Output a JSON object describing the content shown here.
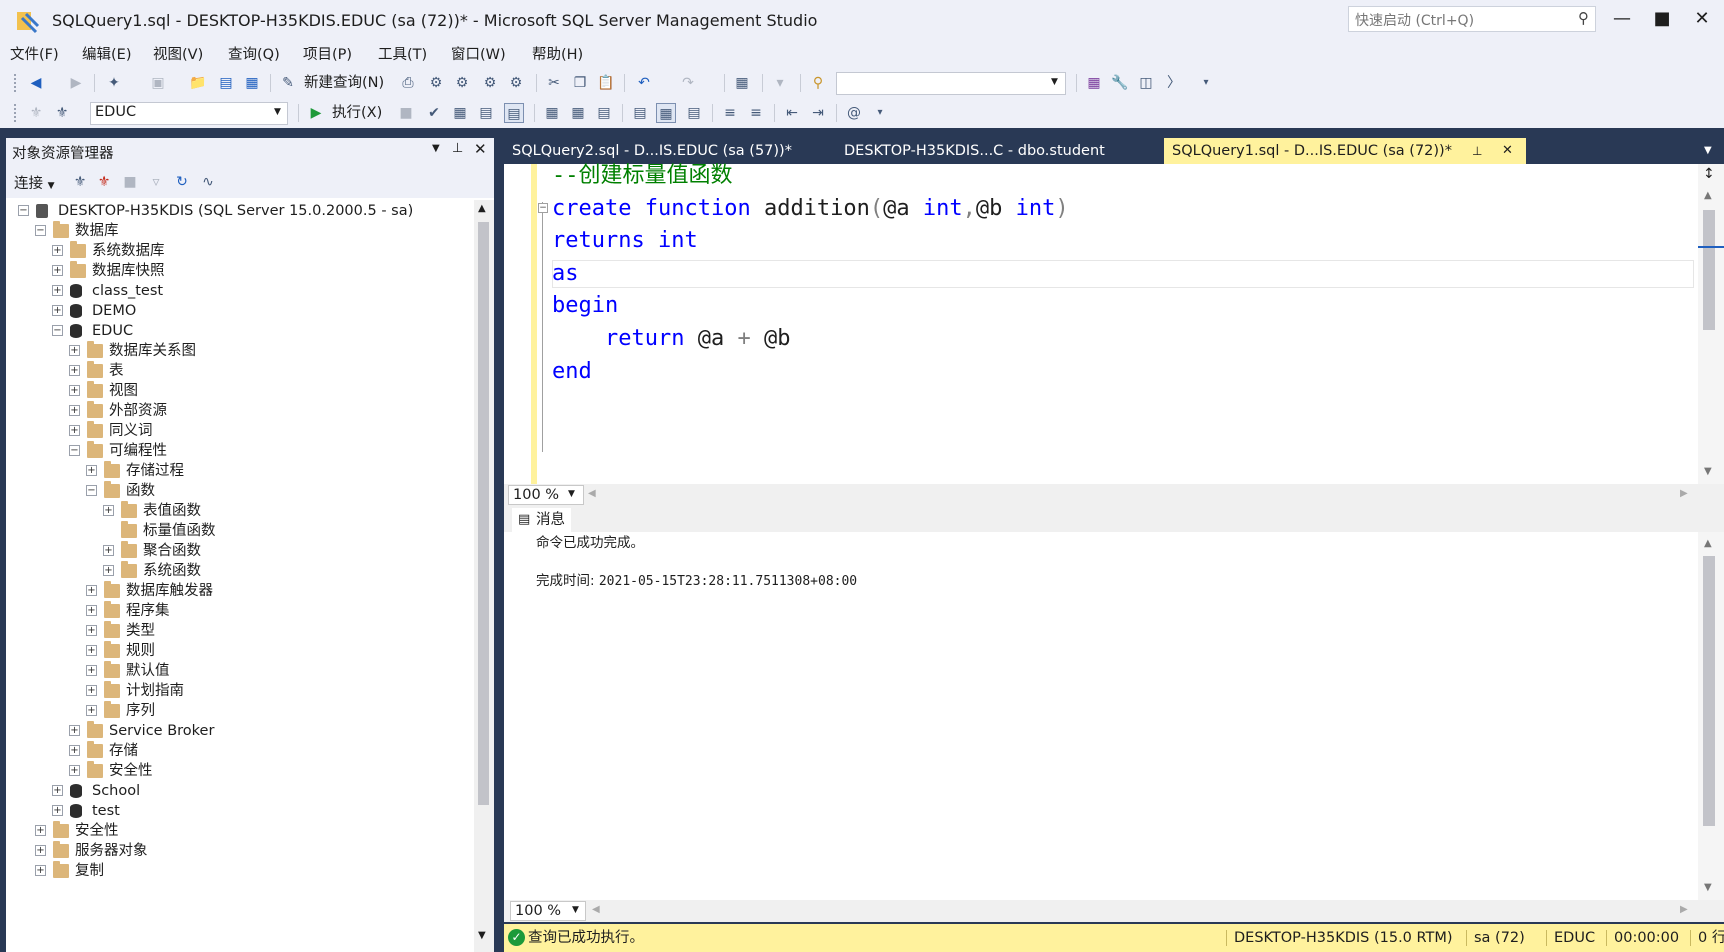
{
  "window": {
    "title": "SQLQuery1.sql - DESKTOP-H35KDIS.EDUC (sa (72))* - Microsoft SQL Server Management Studio",
    "quick_launch_placeholder": "快速启动 (Ctrl+Q)"
  },
  "menu": [
    "文件(F)",
    "编辑(E)",
    "视图(V)",
    "查询(Q)",
    "项目(P)",
    "工具(T)",
    "窗口(W)",
    "帮助(H)"
  ],
  "toolbar": {
    "new_query_label": "新建查询(N)",
    "execute_label": "执行(X)",
    "database_selected": "EDUC"
  },
  "object_explorer": {
    "title": "对象资源管理器",
    "connect_label": "连接",
    "tree": [
      {
        "label": "DESKTOP-H35KDIS (SQL Server 15.0.2000.5 - sa)",
        "level": 0,
        "expander": "−",
        "icon": "server-icon"
      },
      {
        "label": "数据库",
        "level": 1,
        "expander": "−",
        "icon": "folder-icon"
      },
      {
        "label": "系统数据库",
        "level": 2,
        "expander": "+",
        "icon": "folder-icon"
      },
      {
        "label": "数据库快照",
        "level": 2,
        "expander": "+",
        "icon": "folder-icon"
      },
      {
        "label": "class_test",
        "level": 2,
        "expander": "+",
        "icon": "database-icon"
      },
      {
        "label": "DEMO",
        "level": 2,
        "expander": "+",
        "icon": "database-icon"
      },
      {
        "label": "EDUC",
        "level": 2,
        "expander": "−",
        "icon": "database-icon"
      },
      {
        "label": "数据库关系图",
        "level": 3,
        "expander": "+",
        "icon": "folder-icon"
      },
      {
        "label": "表",
        "level": 3,
        "expander": "+",
        "icon": "folder-icon"
      },
      {
        "label": "视图",
        "level": 3,
        "expander": "+",
        "icon": "folder-icon"
      },
      {
        "label": "外部资源",
        "level": 3,
        "expander": "+",
        "icon": "folder-icon"
      },
      {
        "label": "同义词",
        "level": 3,
        "expander": "+",
        "icon": "folder-icon"
      },
      {
        "label": "可编程性",
        "level": 3,
        "expander": "−",
        "icon": "folder-icon"
      },
      {
        "label": "存储过程",
        "level": 4,
        "expander": "+",
        "icon": "folder-icon"
      },
      {
        "label": "函数",
        "level": 4,
        "expander": "−",
        "icon": "folder-icon"
      },
      {
        "label": "表值函数",
        "level": 5,
        "expander": "+",
        "icon": "folder-icon"
      },
      {
        "label": "标量值函数",
        "level": 5,
        "expander": "",
        "icon": "folder-icon"
      },
      {
        "label": "聚合函数",
        "level": 5,
        "expander": "+",
        "icon": "folder-icon"
      },
      {
        "label": "系统函数",
        "level": 5,
        "expander": "+",
        "icon": "folder-icon"
      },
      {
        "label": "数据库触发器",
        "level": 4,
        "expander": "+",
        "icon": "folder-icon"
      },
      {
        "label": "程序集",
        "level": 4,
        "expander": "+",
        "icon": "folder-icon"
      },
      {
        "label": "类型",
        "level": 4,
        "expander": "+",
        "icon": "folder-icon"
      },
      {
        "label": "规则",
        "level": 4,
        "expander": "+",
        "icon": "folder-icon"
      },
      {
        "label": "默认值",
        "level": 4,
        "expander": "+",
        "icon": "folder-icon"
      },
      {
        "label": "计划指南",
        "level": 4,
        "expander": "+",
        "icon": "folder-icon"
      },
      {
        "label": "序列",
        "level": 4,
        "expander": "+",
        "icon": "folder-icon"
      },
      {
        "label": "Service Broker",
        "level": 3,
        "expander": "+",
        "icon": "folder-icon"
      },
      {
        "label": "存储",
        "level": 3,
        "expander": "+",
        "icon": "folder-icon"
      },
      {
        "label": "安全性",
        "level": 3,
        "expander": "+",
        "icon": "folder-icon"
      },
      {
        "label": "School",
        "level": 2,
        "expander": "+",
        "icon": "database-icon"
      },
      {
        "label": "test",
        "level": 2,
        "expander": "+",
        "icon": "database-icon"
      },
      {
        "label": "安全性",
        "level": 1,
        "expander": "+",
        "icon": "folder-icon"
      },
      {
        "label": "服务器对象",
        "level": 1,
        "expander": "+",
        "icon": "folder-icon"
      },
      {
        "label": "复制",
        "level": 1,
        "expander": "+",
        "icon": "folder-icon"
      }
    ]
  },
  "tabs": [
    {
      "label": "SQLQuery2.sql - D...IS.EDUC (sa (57))*",
      "active": false
    },
    {
      "label": "DESKTOP-H35KDIS...C - dbo.student",
      "active": false
    },
    {
      "label": "SQLQuery1.sql - D...IS.EDUC (sa (72))*",
      "active": true
    }
  ],
  "editor": {
    "lines": [
      "--创建标量值函数",
      "create function addition(@a int,@b int)",
      "returns int",
      "as",
      "begin",
      "    return @a + @b",
      "end"
    ],
    "zoom": "100 %"
  },
  "results": {
    "tab_label": "消息",
    "message_line1": "命令已成功完成。",
    "completion_label": "完成时间: ",
    "completion_time": "2021-05-15T23:28:11.7511308+08:00",
    "zoom": "100 %"
  },
  "status": {
    "message": "查询已成功执行。",
    "server": "DESKTOP-H35KDIS (15.0 RTM)",
    "user": "sa (72)",
    "database": "EDUC",
    "elapsed": "00:00:00",
    "rows": "0 行"
  },
  "colors": {
    "accent_yellow": "#fff29d",
    "chrome_dark": "#293955",
    "keyword_blue": "#0000ff",
    "comment_green": "#008000"
  }
}
